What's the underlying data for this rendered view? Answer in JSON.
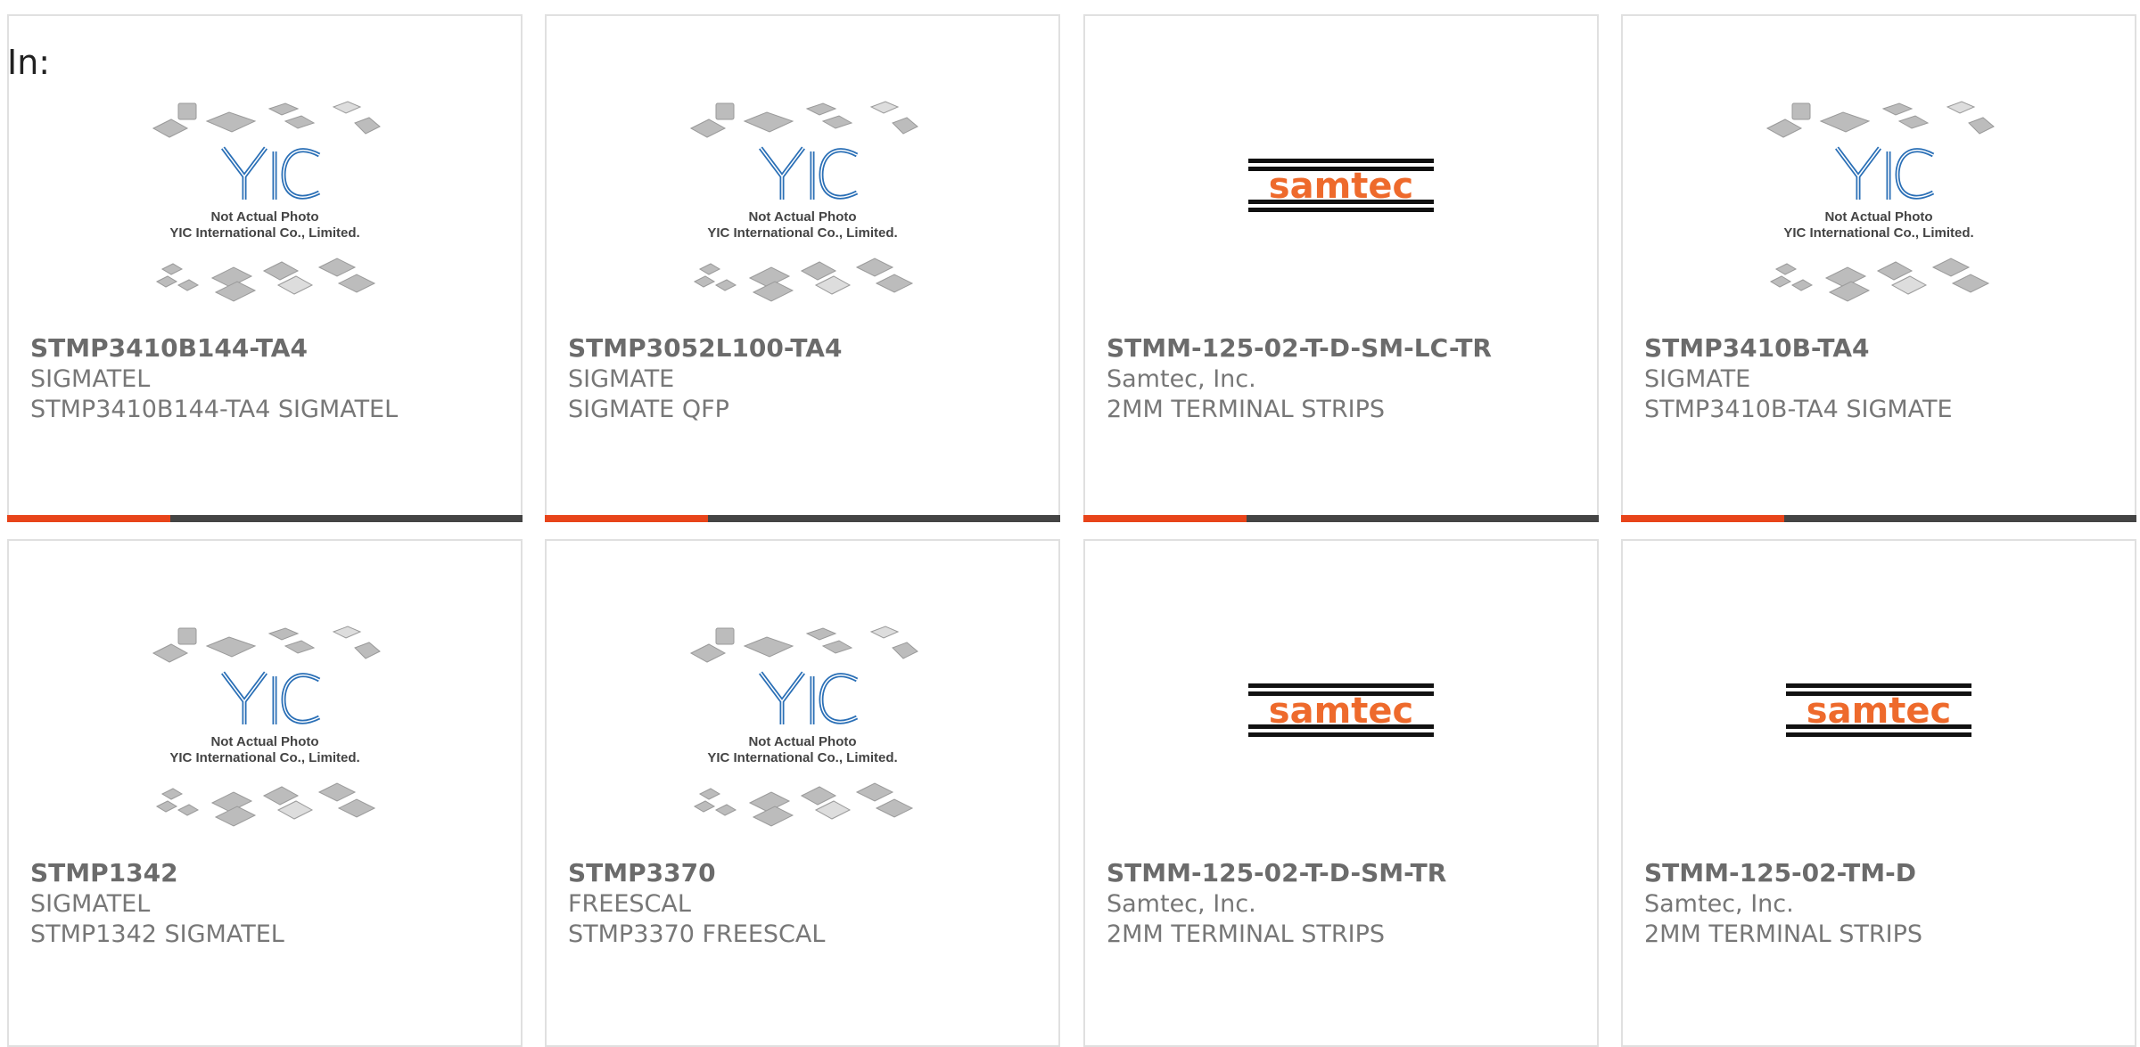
{
  "header": {
    "in_label": "In:"
  },
  "placeholder": {
    "line1": "Not Actual Photo",
    "line2": "YIC International Co., Limited.",
    "brand": "YIC"
  },
  "samtec_logo_text": "samtec",
  "colors": {
    "accent": "#e8441a",
    "bar": "#444444",
    "samtec_orange": "#ee6a2c",
    "yic_blue": "#2a6fb6"
  },
  "products": [
    {
      "name": "STMP3410B144-TA4",
      "manufacturer": "SIGMATEL",
      "description": "STMP3410B144-TA4 SIGMATEL",
      "image": "yic-placeholder"
    },
    {
      "name": "STMP3052L100-TA4",
      "manufacturer": "SIGMATE",
      "description": "SIGMATE QFP",
      "image": "yic-placeholder"
    },
    {
      "name": "STMM-125-02-T-D-SM-LC-TR",
      "manufacturer": "Samtec, Inc.",
      "description": "2MM TERMINAL STRIPS",
      "image": "samtec-logo"
    },
    {
      "name": "STMP3410B-TA4",
      "manufacturer": "SIGMATE",
      "description": "STMP3410B-TA4 SIGMATE",
      "image": "yic-placeholder"
    },
    {
      "name": "STMP1342",
      "manufacturer": "SIGMATEL",
      "description": "STMP1342 SIGMATEL",
      "image": "yic-placeholder"
    },
    {
      "name": "STMP3370",
      "manufacturer": "FREESCAL",
      "description": "STMP3370 FREESCAL",
      "image": "yic-placeholder"
    },
    {
      "name": "STMM-125-02-T-D-SM-TR",
      "manufacturer": "Samtec, Inc.",
      "description": "2MM TERMINAL STRIPS",
      "image": "samtec-logo"
    },
    {
      "name": "STMM-125-02-TM-D",
      "manufacturer": "Samtec, Inc.",
      "description": "2MM TERMINAL STRIPS",
      "image": "samtec-logo"
    }
  ]
}
